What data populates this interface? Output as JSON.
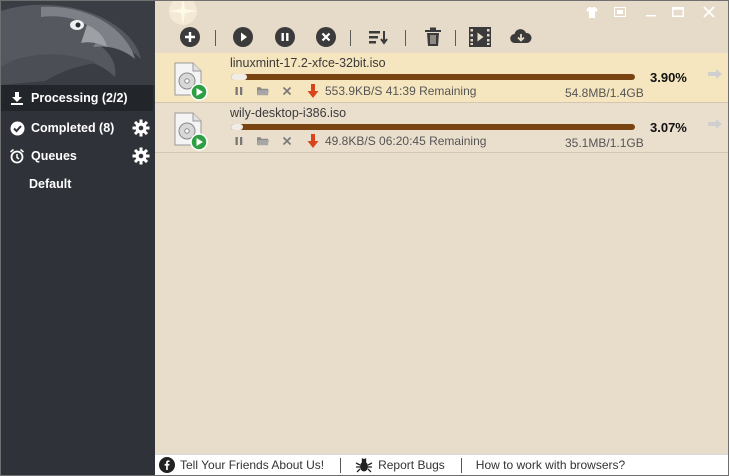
{
  "sidebar": {
    "items": [
      {
        "label": "Processing (2/2)",
        "icon": "download-icon",
        "active": true
      },
      {
        "label": "Completed (8)",
        "icon": "check-circle-icon",
        "active": false
      },
      {
        "label": "Queues",
        "icon": "alarm-clock-icon",
        "active": false
      }
    ],
    "sub_items": [
      {
        "label": "Default"
      }
    ]
  },
  "toolbar": {
    "buttons": [
      "add-icon",
      "play-icon",
      "pause-icon",
      "stop-icon",
      "sort-icon",
      "trash-icon",
      "video-icon",
      "cloud-download-icon"
    ]
  },
  "window_controls": [
    "skin-icon",
    "restore-icon",
    "minimize-icon",
    "maximize-icon",
    "close-icon"
  ],
  "downloads": [
    {
      "name": "linuxmint-17.2-xfce-32bit.iso",
      "progress_text": "3.90%",
      "progress": 0.039,
      "speed": "553.9KB/S 41:39 Remaining",
      "size": "54.8MB/1.4GB"
    },
    {
      "name": "wily-desktop-i386.iso",
      "progress_text": "3.07%",
      "progress": 0.0307,
      "speed": "49.8KB/S 06:20:45 Remaining",
      "size": "35.1MB/1.1GB"
    }
  ],
  "footer": {
    "tell_friends": "Tell Your Friends About Us!",
    "report_bugs": "Report Bugs",
    "browsers": "How to work with browsers?"
  },
  "colors": {
    "sidebar_bg": "#2f3238",
    "main_bg": "#e8dccb",
    "row_highlight": "#f6e6bf",
    "progress_track": "#7a4412",
    "play_green": "#2ea043",
    "download_arrow": "#d9441c"
  }
}
